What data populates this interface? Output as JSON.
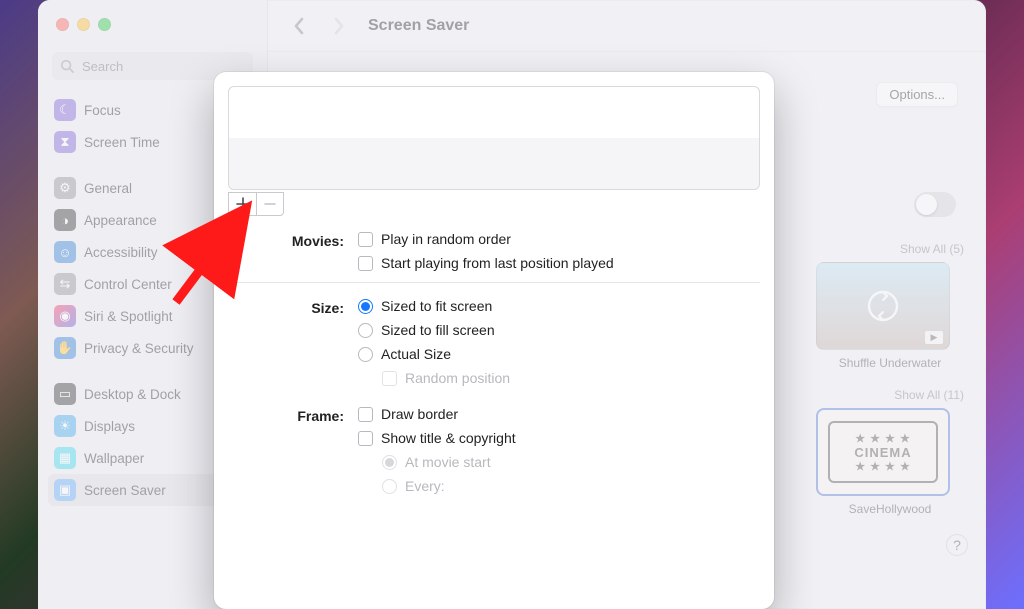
{
  "window": {
    "title": "Screen Saver",
    "search_placeholder": "Search",
    "options_button": "Options...",
    "toggle_on": false
  },
  "sidebar": {
    "items": [
      {
        "label": "Focus"
      },
      {
        "label": "Screen Time"
      },
      {
        "label": "General"
      },
      {
        "label": "Appearance"
      },
      {
        "label": "Accessibility"
      },
      {
        "label": "Control Center"
      },
      {
        "label": "Siri & Spotlight"
      },
      {
        "label": "Privacy & Security"
      },
      {
        "label": "Desktop & Dock"
      },
      {
        "label": "Displays"
      },
      {
        "label": "Wallpaper"
      },
      {
        "label": "Screen Saver"
      }
    ]
  },
  "gallery": {
    "showall_top": "Show All (5)",
    "thumb_shuffle": "Shuffle Underwater",
    "showall_bottom": "Show All (11)",
    "ticket_word": "CINEMA",
    "thumb_cinema": "SaveHollywood"
  },
  "sheet": {
    "movies_label": "Movies:",
    "play_random": "Play in random order",
    "start_last": "Start playing from last position played",
    "size_label": "Size:",
    "size_fit": "Sized to fit screen",
    "size_fill": "Sized to fill screen",
    "size_actual": "Actual Size",
    "random_pos": "Random position",
    "frame_label": "Frame:",
    "draw_border": "Draw border",
    "show_title": "Show title & copyright",
    "at_start": "At movie start",
    "every": "Every:"
  }
}
